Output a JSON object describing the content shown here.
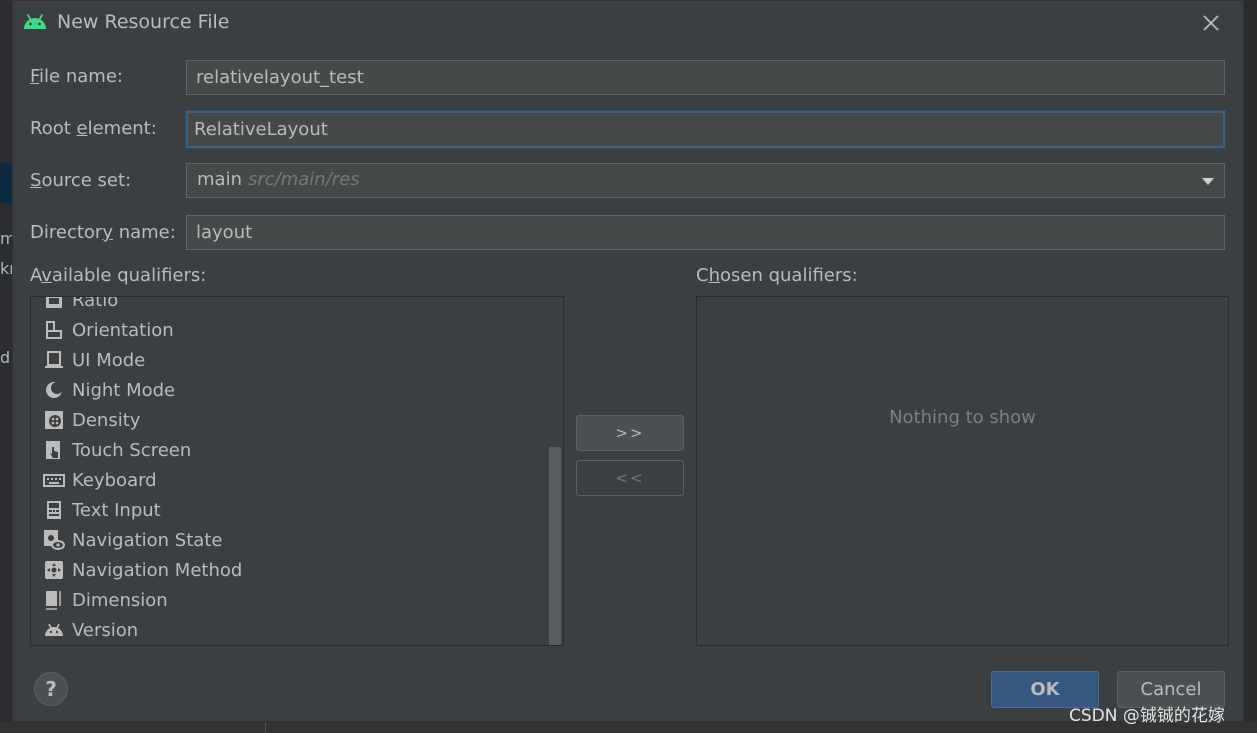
{
  "dialog": {
    "title": "New Resource File"
  },
  "form": {
    "file_name": {
      "label": "File name:",
      "mnemonic": "F",
      "rest": "ile name:",
      "value": "relativelayout_test"
    },
    "root_element": {
      "label": "Root element:",
      "before": "Root ",
      "mnemonic": "e",
      "rest": "lement:",
      "value": "RelativeLayout"
    },
    "source_set": {
      "label": "Source set:",
      "mnemonic": "S",
      "rest": "ource set:",
      "value": "main",
      "hint": "src/main/res"
    },
    "directory_name": {
      "label": "Directory name:",
      "before": "Director",
      "mnemonic": "y",
      "rest": " name:",
      "value": "layout"
    }
  },
  "available": {
    "before": "A",
    "mnemonic": "v",
    "rest": "ailable qualifiers:",
    "items": [
      {
        "label": "Ratio",
        "icon": "ratio-icon"
      },
      {
        "label": "Orientation",
        "icon": "orientation-icon"
      },
      {
        "label": "UI Mode",
        "icon": "ui-mode-icon"
      },
      {
        "label": "Night Mode",
        "icon": "night-mode-icon"
      },
      {
        "label": "Density",
        "icon": "density-icon"
      },
      {
        "label": "Touch Screen",
        "icon": "touch-screen-icon"
      },
      {
        "label": "Keyboard",
        "icon": "keyboard-icon"
      },
      {
        "label": "Text Input",
        "icon": "text-input-icon"
      },
      {
        "label": "Navigation State",
        "icon": "navigation-state-icon"
      },
      {
        "label": "Navigation Method",
        "icon": "navigation-method-icon"
      },
      {
        "label": "Dimension",
        "icon": "dimension-icon"
      },
      {
        "label": "Version",
        "icon": "android-version-icon"
      }
    ]
  },
  "chosen": {
    "before": "C",
    "mnemonic": "h",
    "rest": "osen qualifiers:",
    "empty_text": "Nothing to show"
  },
  "buttons": {
    "add": ">>",
    "remove": "<<",
    "help": "?",
    "ok": "OK",
    "cancel": "Cancel"
  },
  "background": {
    "fragments": [
      "m",
      "kr",
      "d"
    ]
  },
  "watermark": "CSDN @铖铖的花嫁",
  "colors": {
    "dialog_bg": "#3c3f41",
    "field_bg": "#45494a",
    "focus_border": "#3d6185",
    "ok_button": "#365880",
    "android_green": "#3ddc84"
  }
}
